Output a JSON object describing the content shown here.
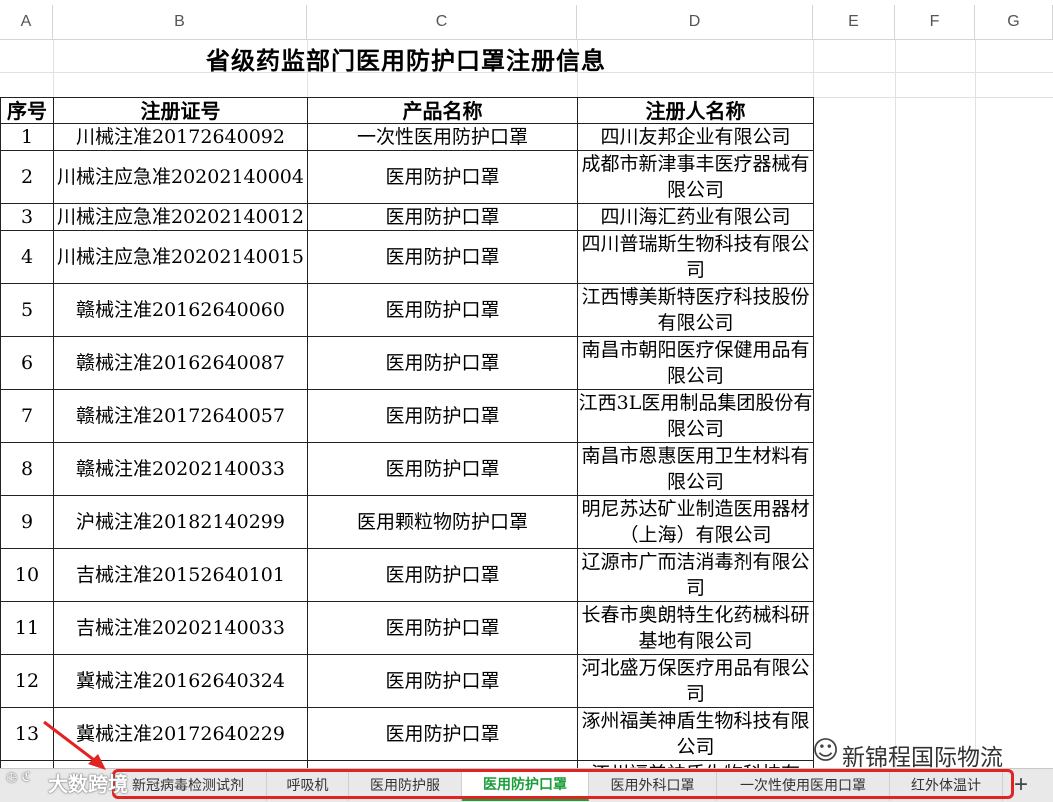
{
  "columns": [
    "A",
    "B",
    "C",
    "D",
    "E",
    "F",
    "G"
  ],
  "sheet": {
    "title": "省级药监部门医用防护口罩注册信息",
    "headers": [
      "序号",
      "注册证号",
      "产品名称",
      "注册人名称"
    ],
    "rows": [
      {
        "no": "1",
        "reg": "川械注准20172640092",
        "product": "一次性医用防护口罩",
        "company": "四川友邦企业有限公司"
      },
      {
        "no": "2",
        "reg": "川械注应急准20202140004",
        "product": "医用防护口罩",
        "company": "成都市新津事丰医疗器械有限公司"
      },
      {
        "no": "3",
        "reg": "川械注应急准20202140012",
        "product": "医用防护口罩",
        "company": "四川海汇药业有限公司"
      },
      {
        "no": "4",
        "reg": "川械注应急准20202140015",
        "product": "医用防护口罩",
        "company": "四川普瑞斯生物科技有限公司"
      },
      {
        "no": "5",
        "reg": "赣械注准20162640060",
        "product": "医用防护口罩",
        "company": "江西博美斯特医疗科技股份有限公司"
      },
      {
        "no": "6",
        "reg": "赣械注准20162640087",
        "product": "医用防护口罩",
        "company": "南昌市朝阳医疗保健用品有限公司"
      },
      {
        "no": "7",
        "reg": "赣械注准20172640057",
        "product": "医用防护口罩",
        "company": "江西3L医用制品集团股份有限公司"
      },
      {
        "no": "8",
        "reg": "赣械注准20202140033",
        "product": "医用防护口罩",
        "company": "南昌市恩惠医用卫生材料有限公司"
      },
      {
        "no": "9",
        "reg": "沪械注准20182140299",
        "product": "医用颗粒物防护口罩",
        "company": "明尼苏达矿业制造医用器材（上海）有限公司"
      },
      {
        "no": "10",
        "reg": "吉械注准20152640101",
        "product": "医用防护口罩",
        "company": "辽源市广而洁消毒剂有限公司"
      },
      {
        "no": "11",
        "reg": "吉械注准20202140033",
        "product": "医用防护口罩",
        "company": "长春市奥朗特生化药械科研基地有限公司"
      },
      {
        "no": "12",
        "reg": "冀械注准20162640324",
        "product": "医用防护口罩",
        "company": "河北盛万保医疗用品有限公司"
      },
      {
        "no": "13",
        "reg": "冀械注准20172640229",
        "product": "医用防护口罩",
        "company": "涿州福美神盾生物科技有限公司"
      },
      {
        "no": "",
        "reg": "",
        "product": "",
        "company": "涿州福美神盾生物科技有"
      }
    ]
  },
  "tabs": [
    "新冠病毒检测试剂",
    "呼吸机",
    "医用防护服",
    "医用防护口罩",
    "医用外科口罩",
    "一次性使用医用口罩",
    "红外体温计"
  ],
  "active_tab": "医用防护口罩",
  "add_sheet": "+",
  "watermarks": {
    "left": "大数跨境",
    "right": "新锦程国际物流"
  },
  "colors": {
    "accent_green": "#1a9e3a",
    "highlight_red": "#e32222"
  }
}
